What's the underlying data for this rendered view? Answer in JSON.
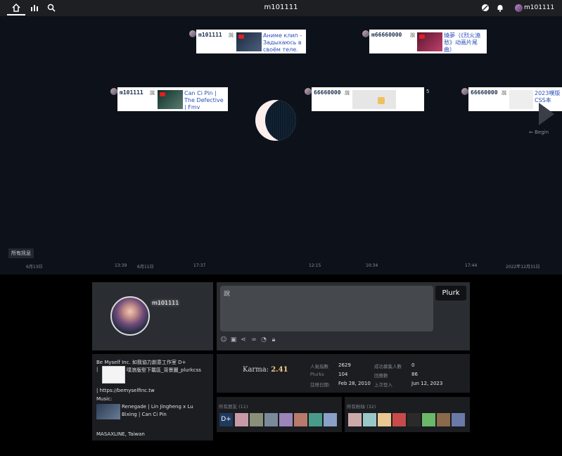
{
  "header": {
    "title": "m101111",
    "username": "m101111"
  },
  "timeline": {
    "plurks": [
      {
        "nick": "m101111",
        "qualifier": "說",
        "text": "Аниме клип - Задыхаюсь в своём теле."
      },
      {
        "nick": "m66660000",
        "qualifier": "說",
        "text": "燒夢（《烈火澆愁》动画片尾曲）"
      },
      {
        "nick": "m101111",
        "qualifier": "說",
        "text": "Can Ci Pin | The Defective | Fmv"
      },
      {
        "nick": "66660000",
        "qualifier": "說",
        "count": "5"
      },
      {
        "nick": "66660000",
        "qualifier": "說",
        "text": "2023噗版CSS本"
      }
    ],
    "begin_label": "Begin",
    "all_messages_label": "所有訊息",
    "ticks": [
      "6月13日",
      "13:39",
      "6月11日",
      "17:37",
      "12:15",
      "10:34",
      "17:44",
      "2022年12月31日"
    ]
  },
  "profile": {
    "name": "m101111"
  },
  "composer": {
    "placeholder": "說",
    "button": "Plurk"
  },
  "about": {
    "line1": "Be Myself Inc. 如我協力創意工作室 D+",
    "line2_sep": "|",
    "line2_text": "噗浪版型下載區_背景圖_plurkcss",
    "line3": "| https://bemyselfinc.tw",
    "music_label": "Music:",
    "music_text1": "Renegade | Lin Jingheng x Lu",
    "music_text2": "Bixing | Can Ci Pin",
    "location": "MASAXLINE, Taiwan"
  },
  "karma": {
    "label": "Karma:",
    "value": "2.41"
  },
  "stats": [
    {
      "label": "人氣指數",
      "value": "2629"
    },
    {
      "label": "成功募集人數",
      "value": "0"
    },
    {
      "label": "Plurks",
      "value": "104"
    },
    {
      "label": "回應數",
      "value": "86"
    },
    {
      "label": "註冊日期:",
      "value": "Feb 28, 2010"
    },
    {
      "label": "上次登入",
      "value": "Jun 12, 2023"
    }
  ],
  "friends": {
    "title": "所有朋友 (11)",
    "badge": "D+"
  },
  "fans": {
    "title": "所有粉絲 (32)"
  },
  "colors": {
    "accent": "#f2c98a",
    "link": "#2a4fb8",
    "panel": "#1b1d21"
  }
}
